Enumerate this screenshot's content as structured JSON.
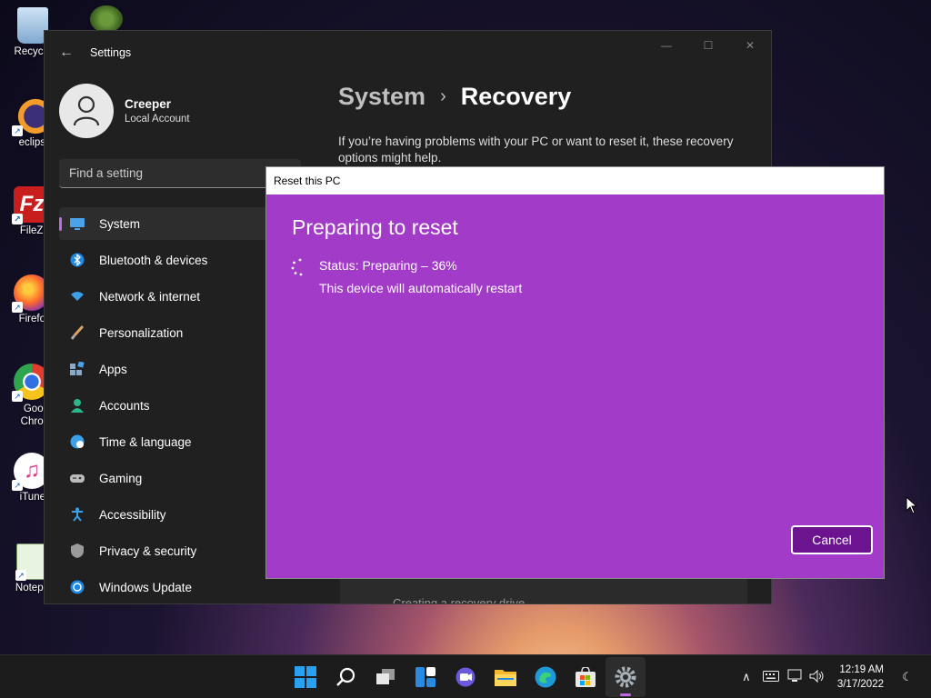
{
  "desktop": {
    "icons": [
      {
        "label": "Recycle"
      },
      {
        "label": ""
      },
      {
        "label": "eclips"
      },
      {
        "label": "FileZi"
      },
      {
        "label": "Firefo"
      },
      {
        "label": "Goog"
      },
      {
        "label": "Chron"
      },
      {
        "label": "iTune"
      },
      {
        "label": "Notepa"
      }
    ]
  },
  "settings": {
    "title": "Settings",
    "user": {
      "name": "Creeper",
      "account_type": "Local Account"
    },
    "search_placeholder": "Find a setting",
    "nav": [
      {
        "label": "System",
        "icon": "monitor-icon",
        "active": true
      },
      {
        "label": "Bluetooth & devices",
        "icon": "bluetooth-icon"
      },
      {
        "label": "Network & internet",
        "icon": "wifi-icon"
      },
      {
        "label": "Personalization",
        "icon": "brush-icon"
      },
      {
        "label": "Apps",
        "icon": "apps-icon"
      },
      {
        "label": "Accounts",
        "icon": "person-icon"
      },
      {
        "label": "Time & language",
        "icon": "globe-clock-icon"
      },
      {
        "label": "Gaming",
        "icon": "gamepad-icon"
      },
      {
        "label": "Accessibility",
        "icon": "accessibility-icon"
      },
      {
        "label": "Privacy & security",
        "icon": "shield-icon"
      },
      {
        "label": "Windows Update",
        "icon": "update-icon"
      }
    ],
    "breadcrumb": {
      "parent": "System",
      "separator": "›",
      "current": "Recovery"
    },
    "intro": "If you’re having problems with your PC or want to reset it, these recovery options might help.",
    "recovery_drive_text": "Creating a recovery drive"
  },
  "reset_dialog": {
    "title": "Reset this PC",
    "heading": "Preparing to reset",
    "status": "Status: Preparing – 36%",
    "progress_percent": 36,
    "note": "This device will automatically restart",
    "cancel_label": "Cancel",
    "accent_color": "#a23bc8"
  },
  "taskbar": {
    "apps": [
      "windows-start-icon",
      "search-icon",
      "task-view-icon",
      "widgets-icon",
      "chat-icon",
      "file-explorer-icon",
      "edge-icon",
      "store-icon",
      "settings-gear-icon"
    ],
    "time": "12:19 AM",
    "date": "3/17/2022"
  },
  "window_controls": {
    "minimize": "—",
    "maximize": "☐",
    "close": "✕"
  }
}
